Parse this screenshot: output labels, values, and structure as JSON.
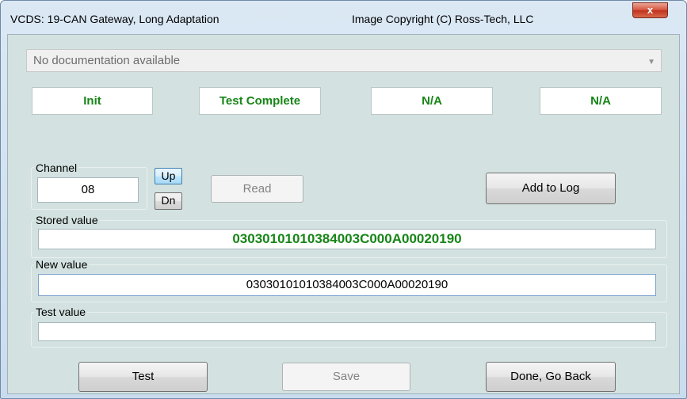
{
  "window": {
    "title": "VCDS: 19-CAN Gateway,  Long Adaptation",
    "copyright": "Image Copyright (C) Ross-Tech, LLC",
    "close_label": "x"
  },
  "documentation": {
    "value": "No documentation available"
  },
  "status": [
    "Init",
    "Test Complete",
    "N/A",
    "N/A"
  ],
  "channel": {
    "label": "Channel",
    "value": "08",
    "up_label": "Up",
    "dn_label": "Dn"
  },
  "buttons": {
    "read": "Read",
    "add_to_log": "Add to Log",
    "test": "Test",
    "save": "Save",
    "done": "Done, Go Back"
  },
  "stored": {
    "label": "Stored value",
    "value": "03030101010384003C000A00020190"
  },
  "new": {
    "label": "New value",
    "value": "03030101010384003C000A00020190"
  },
  "test": {
    "label": "Test value",
    "value": ""
  },
  "colors": {
    "status_green": "#178517",
    "background": "#d3e2e0"
  }
}
